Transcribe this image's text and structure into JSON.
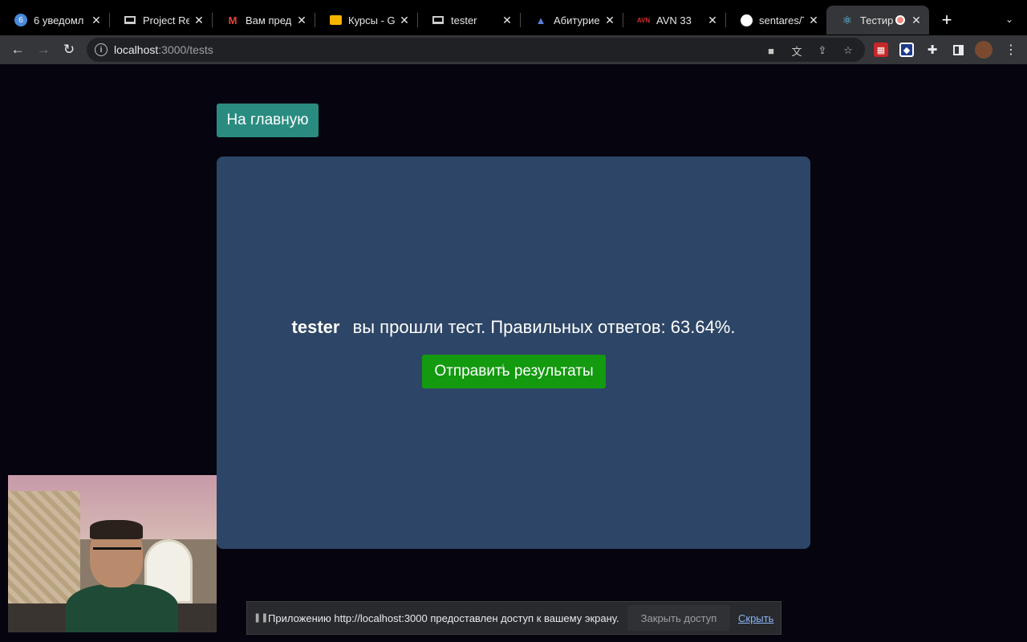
{
  "browser": {
    "tabs": [
      {
        "title": "6 уведомл",
        "icon": "notification-count-icon",
        "badge": "6",
        "color": "#4a89dc"
      },
      {
        "title": "Project Rea",
        "icon": "page-icon"
      },
      {
        "title": "Вам предо",
        "icon": "gmail-icon",
        "color": "#ea4335"
      },
      {
        "title": "Курсы - Go",
        "icon": "classroom-icon",
        "color": "#f4b400"
      },
      {
        "title": "tester",
        "icon": "page-icon"
      },
      {
        "title": "Абитуриен",
        "icon": "university-icon",
        "color": "#2b4fa8"
      },
      {
        "title": "AVN 33",
        "icon": "avn-icon",
        "color": "#d32f2f"
      },
      {
        "title": "sentares/Te",
        "icon": "github-icon"
      },
      {
        "title": "Тестир",
        "icon": "react-icon",
        "color": "#61dafb",
        "active": true,
        "recording": true
      }
    ],
    "url_host": "localhost",
    "url_path": ":3000/tests"
  },
  "page": {
    "home_button": "На главную",
    "username": "tester",
    "result_text": "вы прошли тест. Правильных ответов: 63.64%.",
    "score_percent": 63.64,
    "send_button": "Отправить результаты"
  },
  "share_bar": {
    "message": "Приложению http://localhost:3000 предоставлен доступ к вашему экрану.",
    "stop_button": "Закрыть доступ",
    "hide_link": "Скрыть"
  },
  "colors": {
    "page_background": "#06050f",
    "card_background": "#2d4566",
    "home_button": "#2a8c80",
    "send_button": "#139a0f"
  }
}
